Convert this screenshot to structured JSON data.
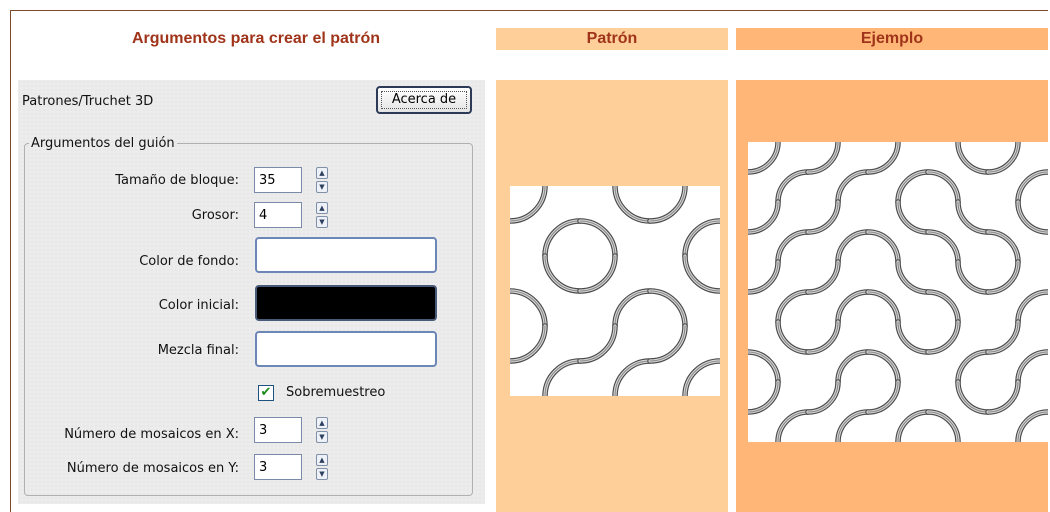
{
  "headers": {
    "args": "Argumentos para crear el patrón",
    "pattern": "Patrón",
    "example": "Ejemplo"
  },
  "dialog": {
    "title": "Patrones/Truchet 3D",
    "about_button": "Acerca de",
    "group_legend": "Argumentos del guión",
    "block_size_label": "Tamaño de bloque:",
    "block_size_value": "35",
    "thickness_label": "Grosor:",
    "thickness_value": "4",
    "bg_color_label": "Color de fondo:",
    "start_color_label": "Color inicial:",
    "end_blend_label": "Mezcla final:",
    "supersample_label": "Sobremuestreo",
    "supersample_checked": true,
    "tiles_x_label": "Número de mosaicos en X:",
    "tiles_x_value": "3",
    "tiles_y_label": "Número de mosaicos en Y:",
    "tiles_y_value": "3"
  },
  "colors": {
    "header_text": "#a0341a",
    "pattern_bg": "#ffcf9a",
    "example_bg": "#ffb677",
    "start_color": "#000000",
    "bg_color": "#ffffff",
    "end_blend": "#ffffff"
  },
  "icons": {
    "spinner": "spin-arrows-icon",
    "checkbox": "check-icon"
  }
}
